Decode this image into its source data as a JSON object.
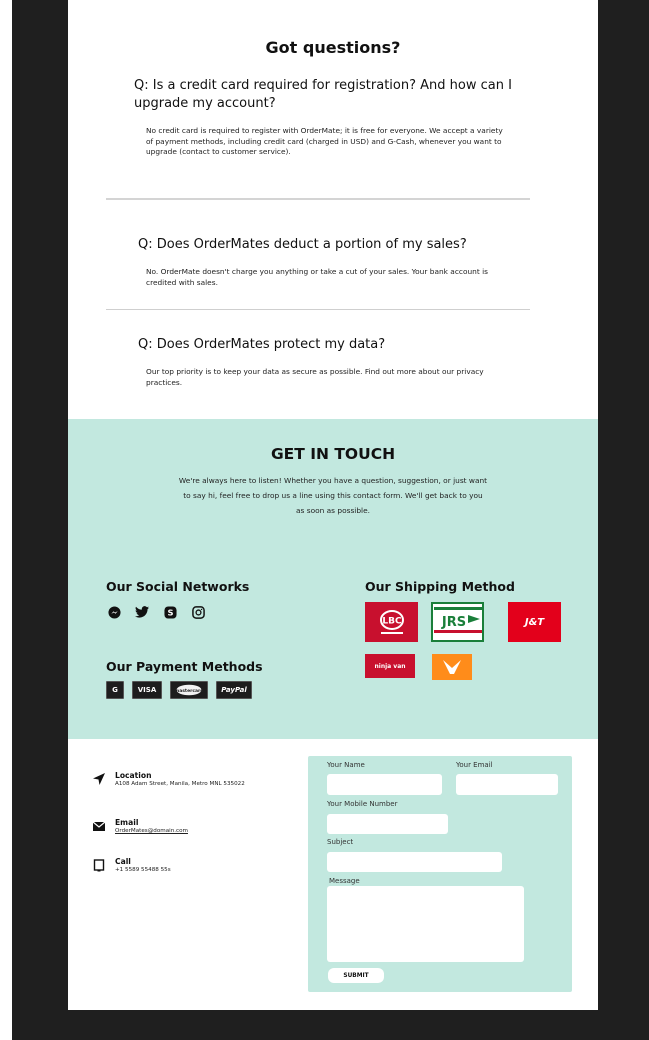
{
  "faq": {
    "title": "Got questions?",
    "items": [
      {
        "question": "Q: Is a credit card required for registration? And how can I upgrade my account?",
        "answer": "No credit card is required to register with OrderMate; it is free for everyone. We accept a variety of payment methods, including credit card (charged in USD) and G-Cash, whenever you want to upgrade (contact to customer service)."
      },
      {
        "question": "Q: Does OrderMates deduct a portion of my sales?",
        "answer": "No. OrderMate doesn't charge you anything or take a cut of your sales. Your bank account is credited with sales."
      },
      {
        "question": "Q: Does OrderMates protect my data?",
        "answer": "Our top priority is to keep your data as secure as possible. Find out more about our privacy practices."
      }
    ]
  },
  "touch": {
    "title": "GET IN TOUCH",
    "text": "We're always here to listen! Whether you have a question, suggestion, or just want to say hi, feel free to drop us a line using this contact form. We'll get back to you as soon as possible.",
    "social_heading": "Our Social Networks",
    "social_icons": [
      "messenger-icon",
      "twitter-icon",
      "skype-icon",
      "instagram-icon"
    ],
    "payment_heading": "Our Payment Methods",
    "payment_methods": [
      "G",
      "VISA",
      "mastercard",
      "PayPal"
    ],
    "shipping_heading": "Our Shipping Method",
    "shipping": [
      {
        "name": "LBC",
        "color": "#c8102e"
      },
      {
        "name": "JRS",
        "color": "#1a7f3a"
      },
      {
        "name": "J&T",
        "color": "#e3001b"
      },
      {
        "name": "ninja van",
        "color": "#c8102e"
      },
      {
        "name": "flash",
        "color": "#ff8c1a"
      }
    ]
  },
  "contact": {
    "location_label": "Location",
    "location_value": "A108 Adam Street, Manila, Metro MNL 535022",
    "email_label": "Email",
    "email_value": "OrderMates@domain.com",
    "call_label": "Call",
    "call_value": "+1 5589 55488 55s"
  },
  "form": {
    "name_label": "Your Name",
    "email_label": "Your Email",
    "mobile_label": "Your Mobile Number",
    "subject_label": "Subject",
    "message_label": "Message",
    "submit_label": "SUBMIT"
  },
  "colors": {
    "band": "#c2e8df",
    "frame": "#1f1f1f"
  }
}
